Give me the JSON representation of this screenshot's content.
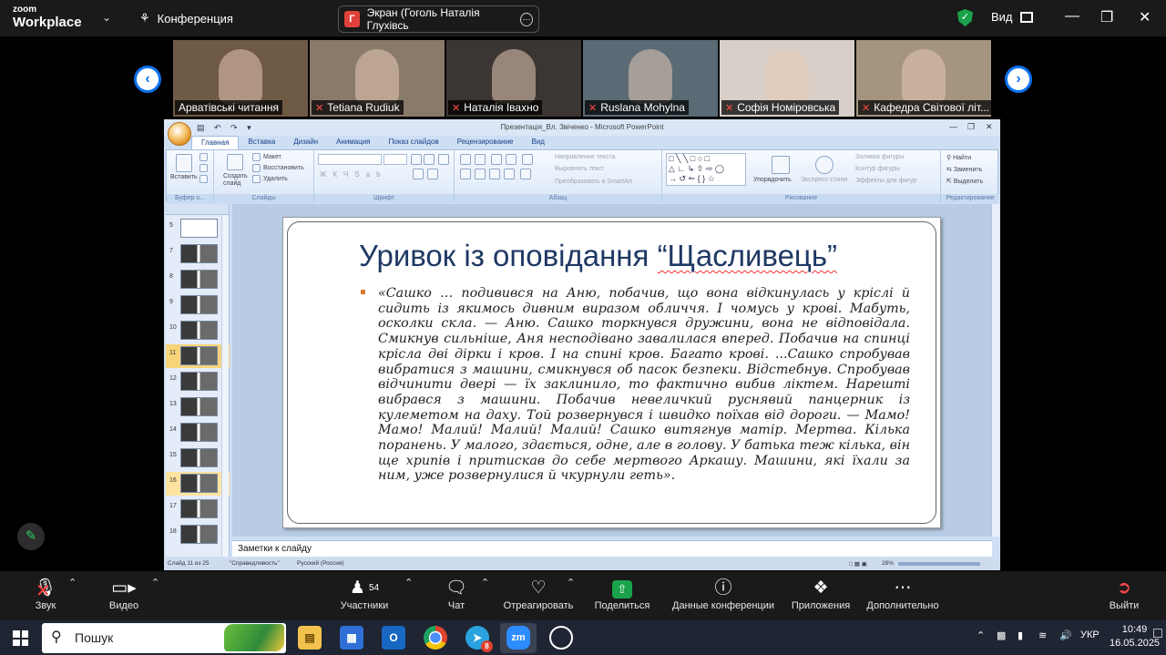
{
  "zoom_top": {
    "logo_line1": "zoom",
    "logo_line2": "Workplace",
    "conference_label": "Конференция",
    "share_badge": "Г",
    "share_title": "Экран (Гоголь Наталія Глухівсь",
    "view_label": "Вид"
  },
  "participants": [
    {
      "name": "Арватівські читання",
      "muted": false,
      "bg": "#6f5a45"
    },
    {
      "name": "Tetiana Rudiuk",
      "muted": true,
      "bg": "#8a7a6a"
    },
    {
      "name": "Наталія Івахно",
      "muted": true,
      "bg": "#3b3633"
    },
    {
      "name": "Ruslana Mohylna",
      "muted": true,
      "bg": "#5a6b75"
    },
    {
      "name": "Софія Номіровська",
      "muted": true,
      "bg": "#d8d0c8"
    },
    {
      "name": "Кафедра Світової літ...",
      "muted": true,
      "bg": "#a49480"
    }
  ],
  "ppt": {
    "window_title": "Презентація_Вл. Звіченко - Microsoft PowerPoint",
    "tabs": [
      "Главная",
      "Вставка",
      "Дизайн",
      "Анимация",
      "Показ слайдов",
      "Рецензирование",
      "Вид"
    ],
    "ribbon": {
      "paste": "Вставить",
      "clipboard_group": "Буфер о...",
      "create_slide": "Создать слайд",
      "layout": "Макет",
      "reset": "Восстановить",
      "delete": "Удалить",
      "slides_group": "Слайды",
      "font_group": "Шрифт",
      "paragraph_group": "Абзац",
      "text_direction": "Направление текста",
      "align_text": "Выровнять текст",
      "smartart": "Преобразовать в SmartArt",
      "arrange": "Упорядочить",
      "quick_styles": "Экспресс-стили",
      "shape_fill": "Заливка фигуры",
      "shape_outline": "Контур фигуры",
      "shape_effects": "Эффекты для фигур",
      "drawing_group": "Рисование",
      "find": "Найти",
      "replace": "Заменить",
      "select": "Выделить",
      "editing_group": "Редактирование"
    },
    "slide_numbers": [
      "5",
      "7",
      "8",
      "9",
      "10",
      "11",
      "12",
      "13",
      "14",
      "15",
      "16",
      "17",
      "18"
    ],
    "slide_title_plain": "Уривок із оповідання ",
    "slide_title_quoted": "“Щасливець”",
    "slide_text": "«Сашко … подивився на Аню, побачив, що вона відкинулась у кріслі й сидить із якимось дивним виразом обличчя. І чомусь у крові. Мабуть, осколки скла. — Аню. Сашко торкнувся дружини, вона не відповідала. Смикнув сильніше, Аня несподівано завалилася вперед. Побачив на спинці крісла дві дірки і кров. І на спині кров. Багато крові. ...Сашко спробував вибратися з машини, смикнувся об пасок безпеки. Відстебнув. Спробував відчинити двері — їх заклинило, то фактично вибив ліктем. Нарешті вибрався з машини. Побачив невеличкий руснявий панцерник із кулеметом на даху. Той розвернувся і швидко поїхав від дороги. — Мамо! Мамо! Малий! Малий! Малий! Сашко витягнув матір. Мертва. Кілька поранень. У малого, здається, одне, але в голову. У батька теж кілька, він ще хрипів і притискав до себе мертвого Аркашу. Машини, які їхали за ним, уже розвернулися й чкурнули геть».",
    "notes_placeholder": "Заметки к слайду",
    "status_slide": "Слайд 11 из 25",
    "status_theme": "\"Справедливость\"",
    "status_lang": "Русский (Россия)",
    "status_zoom": "28%"
  },
  "zoom_bottom": {
    "audio": "Звук",
    "video": "Видео",
    "participants": "Участники",
    "participants_count": "54",
    "chat": "Чат",
    "react": "Отреагировать",
    "share": "Поделиться",
    "meeting_info": "Данные конференции",
    "apps": "Приложения",
    "more": "Дополнительно",
    "leave": "Выйти"
  },
  "taskbar": {
    "search_placeholder": "Пошук",
    "telegram_badge": "8",
    "zoom_icon": "zm",
    "language": "УКР",
    "time": "10:49",
    "date": "16.05.2025"
  }
}
